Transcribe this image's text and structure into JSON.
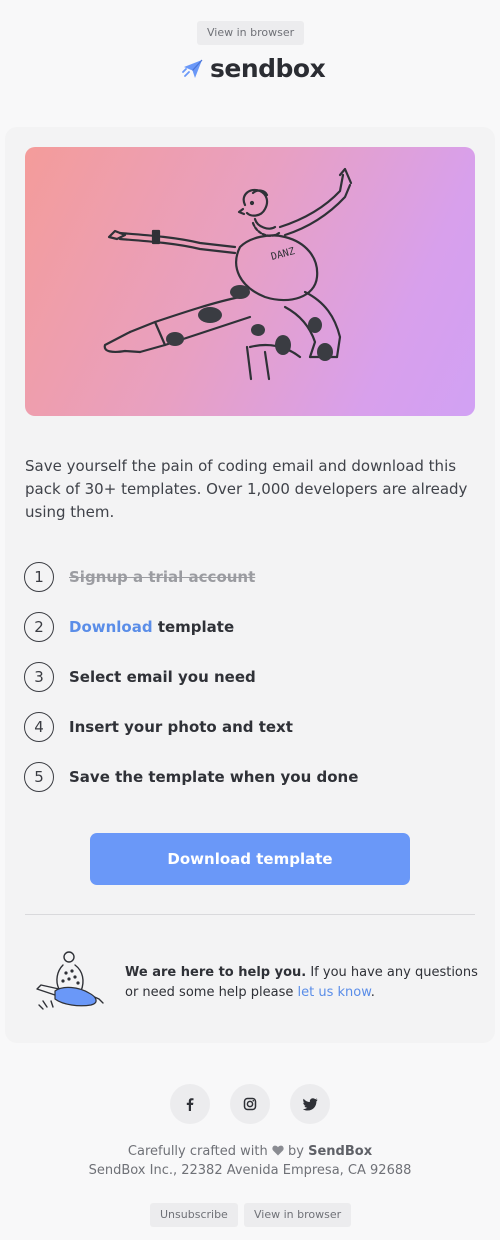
{
  "header": {
    "view_in_browser": "View in browser",
    "logo_text": "sendbox"
  },
  "hero": {
    "shirt_text": "DANZ",
    "gradient_start": "#f49c9a",
    "gradient_end": "#d1a1f4"
  },
  "intro": "Save yourself the pain of coding email and download this pack of 30+ templates. Over 1,000 developers are already using them.",
  "steps": [
    {
      "num": "1",
      "text": "Signup a trial account",
      "done": true
    },
    {
      "num": "2",
      "link": "Download",
      "text": " template"
    },
    {
      "num": "3",
      "text": "Select email you need"
    },
    {
      "num": "4",
      "text": "Insert your photo and text"
    },
    {
      "num": "5",
      "text": "Save the template when you done"
    }
  ],
  "cta_label": "Download template",
  "help": {
    "bold": "We are here to help you.",
    "text": " If you have any questions or need some help please ",
    "link": "let us know",
    "end": "."
  },
  "social": [
    "facebook-icon",
    "instagram-icon",
    "twitter-icon"
  ],
  "footer": {
    "crafted": "Carefully crafted with",
    "by": "by",
    "brand": "SendBox",
    "address": "SendBox Inc., 22382 Avenida Empresa, CA 92688",
    "unsubscribe": "Unsubscribe",
    "view_in_browser": "View in browser"
  },
  "colors": {
    "accent": "#6a98f8",
    "link": "#5a8de8",
    "card": "#f3f3f4"
  }
}
